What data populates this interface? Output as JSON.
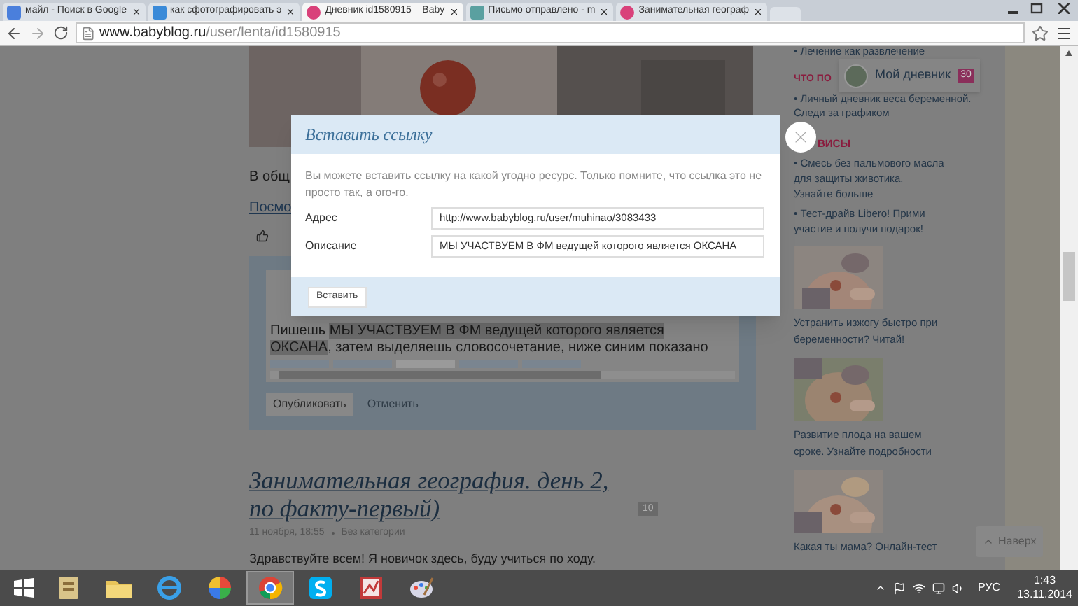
{
  "browser": {
    "tabs": [
      {
        "kind": "google",
        "label": "майл - Поиск в Google",
        "selected": false
      },
      {
        "kind": "search",
        "label": "как сфотографировать э",
        "selected": false
      },
      {
        "kind": "blog",
        "label": "Дневник id1580915 – Baby",
        "selected": true
      },
      {
        "kind": "mail",
        "label": "Письмо отправлено - m",
        "selected": false
      },
      {
        "kind": "blog",
        "label": "Занимательная географ",
        "selected": false
      }
    ],
    "address": {
      "host": "www.babyblog.ru",
      "path": "/user/lenta/id1580915"
    }
  },
  "post": {
    "intro": "В общ",
    "link": "Посмо",
    "editor": {
      "before": "Пишешь ",
      "highlight": "МЫ УЧАСТВУЕМ В ФМ ведущей которого является ОКСАНА",
      "after": ", затем выделяешь словосочетание, ниже синим показано"
    },
    "publish": "Опубликовать",
    "cancel": "Отменить"
  },
  "next_post": {
    "title": "Занимательная география. день 2, по факту-первый)",
    "comments": "10",
    "date": "11 ноября, 18:55",
    "category": "Без категории",
    "text": "Здравствуйте всем! Я новичок здесь, буду учиться по ходу."
  },
  "sidebar": {
    "top_link": "• Лечение как развлечение",
    "heading_1": "ЧТО ПО",
    "links_1": [
      "• Личный дневник веса беременной. Следи за графиком"
    ],
    "heading_2": "ВИСЫ",
    "links_2": [
      "• Смесь без пальмового масла для защиты животика. Узнайте больше",
      "• Тест-драйв Libero! Прими участие и получи подарок!"
    ],
    "promos": [
      {
        "kind": "picture",
        "caption": "Устранить изжогу быстро при беременности? Читай!"
      },
      {
        "kind": "picture",
        "caption": "Развитие плода на вашем сроке. Узнайте подробности"
      },
      {
        "kind": "picture",
        "caption": "Какая ты мама? Онлайн-тест"
      }
    ]
  },
  "my_diary": {
    "label": "Мой дневник",
    "count": "30"
  },
  "to_top": "Наверх",
  "dialog": {
    "title": "Вставить ссылку",
    "message": "Вы можете вставить ссылку на какой угодно ресурс. Только помните, что ссылка это не просто так, а ого-го.",
    "fields": [
      {
        "label": "Адрес",
        "value": "http://www.babyblog.ru/user/muhinao/3083433"
      },
      {
        "label": "Описание",
        "value": "МЫ УЧАСТВУЕМ В ФМ ведущей которого является ОКСАНА"
      }
    ],
    "submit": "Вставить"
  },
  "taskbar": {
    "apps": [
      {
        "kind": "notes",
        "selected": false
      },
      {
        "kind": "explorer",
        "selected": false
      },
      {
        "kind": "ie",
        "selected": false
      },
      {
        "kind": "picasa",
        "selected": false
      },
      {
        "kind": "chrome",
        "selected": true
      },
      {
        "kind": "skype",
        "selected": false
      },
      {
        "kind": "office",
        "selected": false
      },
      {
        "kind": "paint",
        "selected": false
      }
    ],
    "language": "РУС",
    "time": "1:43",
    "date": "13.11.2014"
  }
}
